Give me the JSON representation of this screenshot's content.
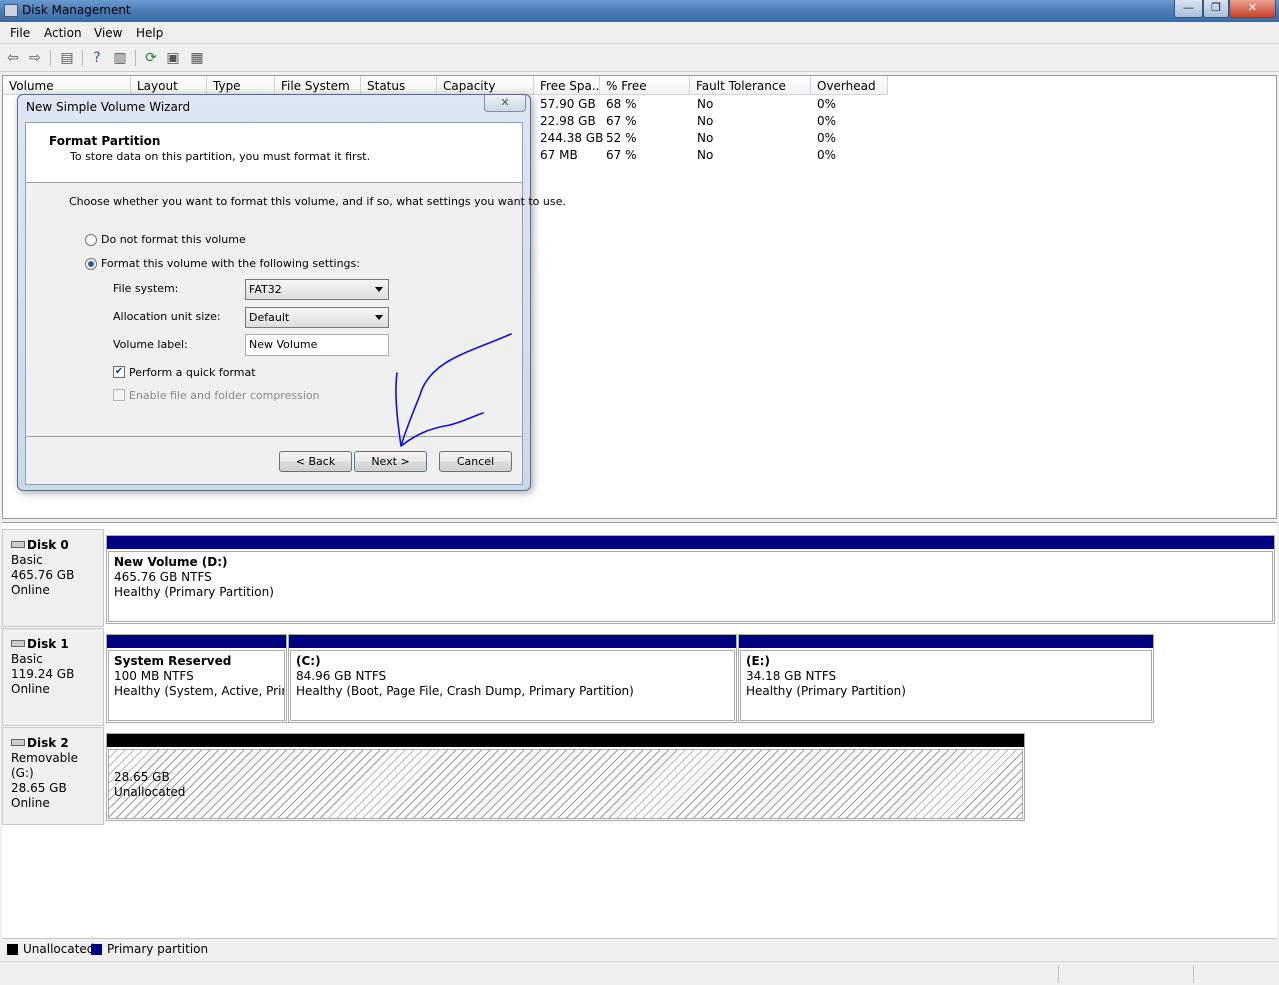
{
  "window": {
    "title": "Disk Management",
    "controls": [
      "—",
      "❐",
      "✕"
    ]
  },
  "menu": [
    "File",
    "Action",
    "View",
    "Help"
  ],
  "toolbar": {
    "icons": [
      "back-arrow-icon",
      "forward-arrow-icon",
      "console-tree-icon",
      "help-icon",
      "properties-icon",
      "refresh-icon",
      "settings-icon",
      "console-icon"
    ]
  },
  "volume_list": {
    "columns": [
      "Volume",
      "Layout",
      "Type",
      "File System",
      "Status",
      "Capacity",
      "Free Spa...",
      "% Free",
      "Fault Tolerance",
      "Overhead"
    ],
    "rows": [
      {
        "free": "57.90 GB",
        "pct": "68 %",
        "fault": "No",
        "overhead": "0%"
      },
      {
        "free": "22.98 GB",
        "pct": "67 %",
        "fault": "No",
        "overhead": "0%"
      },
      {
        "free": "244.38 GB",
        "pct": "52 %",
        "fault": "No",
        "overhead": "0%"
      },
      {
        "free": "67 MB",
        "pct": "67 %",
        "fault": "No",
        "overhead": "0%"
      }
    ]
  },
  "disks": [
    {
      "name": "Disk 0",
      "type": "Basic",
      "size": "465.76 GB",
      "status": "Online",
      "partitions": [
        {
          "name": "New Volume  (D:)",
          "size": "465.76 GB NTFS",
          "status": "Healthy (Primary Partition)"
        }
      ]
    },
    {
      "name": "Disk 1",
      "type": "Basic",
      "size": "119.24 GB",
      "status": "Online",
      "partitions": [
        {
          "name": "System Reserved",
          "size": "100 MB NTFS",
          "status": "Healthy (System, Active, Primar"
        },
        {
          "name": "(C:)",
          "size": "84.96 GB NTFS",
          "status": "Healthy (Boot, Page File, Crash Dump, Primary Partition)"
        },
        {
          "name": "(E:)",
          "size": "34.18 GB NTFS",
          "status": "Healthy (Primary Partition)"
        }
      ]
    },
    {
      "name": "Disk 2",
      "type": "Removable (G:)",
      "size": "28.65 GB",
      "status": "Online",
      "partitions": [
        {
          "name": "",
          "size": "28.65 GB",
          "status": "Unallocated"
        }
      ]
    }
  ],
  "legend": [
    {
      "label": "Unallocated",
      "color": "#000000"
    },
    {
      "label": "Primary partition",
      "color": "#000080"
    }
  ],
  "wizard": {
    "title": "New Simple Volume Wizard",
    "close": "✕",
    "header_title": "Format Partition",
    "header_subtitle": "To store data on this partition, you must format it first.",
    "instruction": "Choose whether you want to format this volume, and if so, what settings you want to use.",
    "option_no_format": "Do not format this volume",
    "option_format": "Format this volume with the following settings:",
    "file_system_label": "File system:",
    "file_system_value": "FAT32",
    "alloc_label": "Allocation unit size:",
    "alloc_value": "Default",
    "volume_label_label": "Volume label:",
    "volume_label_value": "New Volume",
    "quick_format": "Perform a quick format",
    "quick_format_checked": true,
    "compression": "Enable file and folder compression",
    "compression_enabled": false,
    "back": "< Back",
    "next": "Next >",
    "cancel": "Cancel"
  },
  "annotation_color": "#1010d0"
}
